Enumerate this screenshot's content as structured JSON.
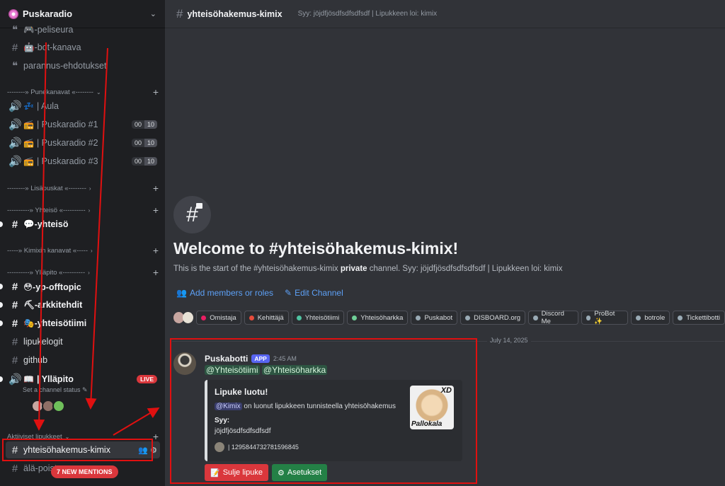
{
  "server": {
    "name": "Puskaradio"
  },
  "sidebar": {
    "channels": [
      {
        "name": "🎮-peliseura"
      },
      {
        "name": "🤖-bot-kanava"
      },
      {
        "name": "parannus-ehdotukset"
      }
    ],
    "cat_punekanavat": "--------» Punekanavat «--------",
    "voice": [
      {
        "emoji": "💤",
        "name": "| Aula"
      },
      {
        "emoji": "📻",
        "name": "| Puskaradio #1",
        "count": "00",
        "limit": "10"
      },
      {
        "emoji": "📻",
        "name": "| Puskaradio #2",
        "count": "00",
        "limit": "10"
      },
      {
        "emoji": "📻",
        "name": "| Puskaradio #3",
        "count": "00",
        "limit": "10"
      }
    ],
    "cat_lisapuskat": "--------» Lisäpuskat «--------",
    "cat_yhteiso": "----------» Yhteisö «----------",
    "yhteiso_channel": "💬-yhteisö",
    "cat_kimixin": "-----» Kimixin kanavat «-----",
    "cat_yllapito": "----------» Ylläpito «----------",
    "yllapito_channels": [
      {
        "name": "😳-yp-offtopic"
      },
      {
        "name": "⛏-arkkitehdit"
      },
      {
        "name": "🎭-yhteisötiimi"
      },
      {
        "name": "lipukelogit"
      },
      {
        "name": "github"
      }
    ],
    "stage": {
      "emoji": "📖",
      "name": "| Ylläpito",
      "live": "LIVE",
      "status": "Set a channel status ✎"
    },
    "cat_aktiiviset": "Aktiiviset lipukkeet",
    "selected_channel": "yhteisöhakemus-kimix",
    "next_channel": "älä-poista",
    "new_mentions": "7 NEW MENTIONS"
  },
  "header": {
    "channel": "yhteisöhakemus-kimix",
    "topic": "Syy: jöjdfjösdfsdfsdfsdf | Lipukkeen loi: kimix"
  },
  "welcome": {
    "title": "Welcome to #yhteisöhakemus-kimix!",
    "sub_pre": "This is the start of the #yhteisöhakemus-kimix ",
    "sub_bold": "private",
    "sub_post": " channel. Syy: jöjdfjösdfsdfsdfsdf | Lipukkeen loi: kimix",
    "add_members": "Add members or roles",
    "edit_channel": "Edit Channel"
  },
  "roles": [
    {
      "name": "Omistaja",
      "color": "#e91e63"
    },
    {
      "name": "Kehittäjä",
      "color": "#e74c3c"
    },
    {
      "name": "Yhteisötiimi",
      "color": "#4fc3a1"
    },
    {
      "name": "Yhteisöharkka",
      "color": "#6fcf97"
    },
    {
      "name": "Puskabot",
      "color": "#99aab5"
    },
    {
      "name": "DISBOARD.org",
      "color": "#99aab5"
    },
    {
      "name": "Discord Me",
      "color": "#99aab5"
    },
    {
      "name": "ProBot ✨",
      "color": "#99aab5"
    },
    {
      "name": "botrole",
      "color": "#99aab5"
    },
    {
      "name": "Tickettibotti",
      "color": "#99aab5"
    }
  ],
  "date_divider": "July 14, 2025",
  "message": {
    "author": "Puskabotti",
    "badge": "APP",
    "time": "2:45 AM",
    "mention1": "@Yhteisötiimi",
    "mention2": "@Yhteisöharkka",
    "embed": {
      "title": "Lipuke luotu!",
      "user_mention": "@Kimix",
      "desc": " on luonut lipukkeen tunnisteella yhteisöhakemus",
      "field_label": "Syy:",
      "field_value": "jöjdfjösdfsdfsdfsdf",
      "footer": "| 1295844732781596845",
      "thumb_top": "XD",
      "thumb_bottom": "Pallokala"
    },
    "btn_close": "Sulje lipuke",
    "btn_settings": "Asetukset"
  },
  "colors": {
    "accent": "#5865f2",
    "danger": "#da373c",
    "success": "#248046",
    "annotation": "#e01010"
  }
}
